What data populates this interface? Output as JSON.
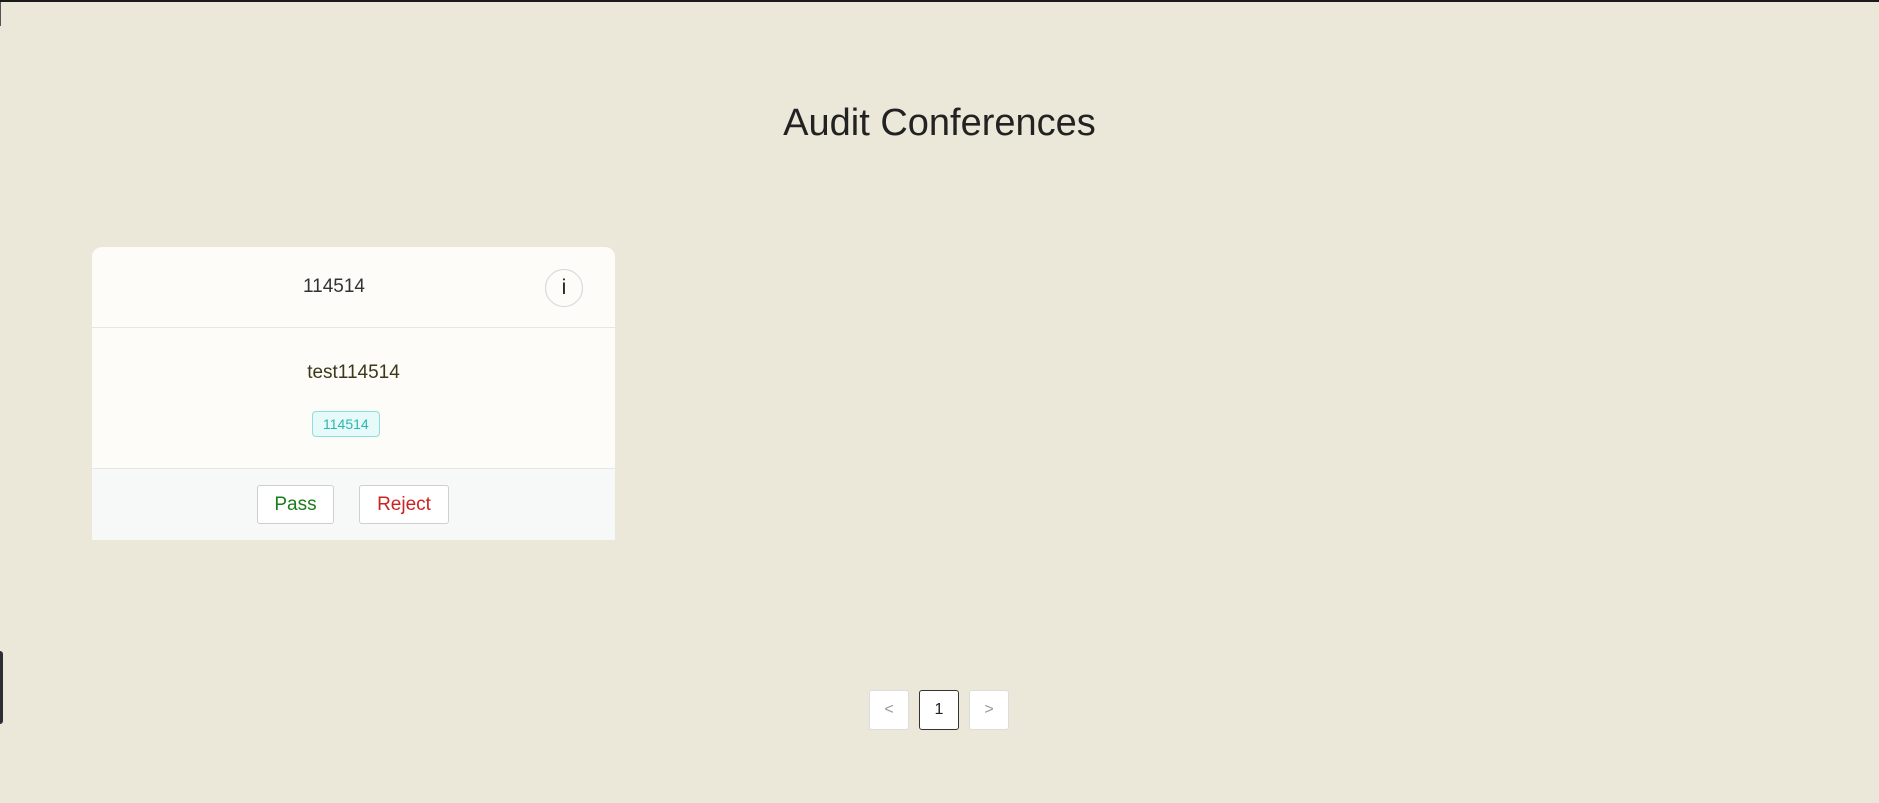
{
  "page": {
    "title": "Audit Conferences"
  },
  "card": {
    "header_title": "114514",
    "info_icon": "info-icon",
    "info_label": "i",
    "body_title": "test114514",
    "tag": "114514",
    "pass_label": "Pass",
    "reject_label": "Reject"
  },
  "pagination": {
    "prev_icon": "chevron-left-icon",
    "prev_label": "<",
    "current_page": "1",
    "next_icon": "chevron-right-icon",
    "next_label": ">"
  },
  "colors": {
    "background": "#ebe8da",
    "card": "#fdfcf8",
    "pass": "#1a7d1a",
    "reject": "#cc2222",
    "tag_text": "#2bb7ae",
    "tag_border": "#8be0db"
  }
}
